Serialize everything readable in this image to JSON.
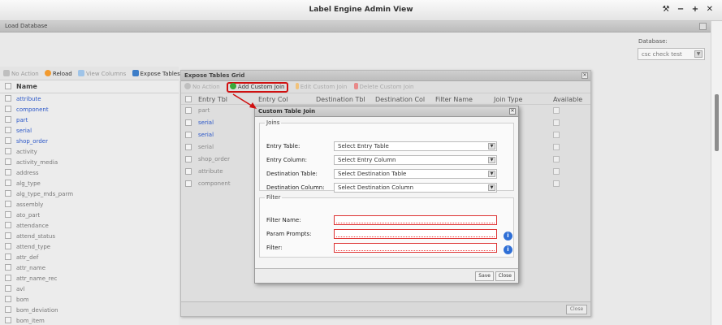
{
  "window": {
    "title": "Label Engine Admin View",
    "controls": "⚒ − + ✕"
  },
  "load_database": {
    "label": "Load Database"
  },
  "database": {
    "label": "Database:",
    "selected": "csc check test"
  },
  "left_toolbar": {
    "no_action": "No Action",
    "reload": "Reload",
    "view_columns": "View Columns",
    "expose_tables": "Expose Tables"
  },
  "left_grid": {
    "header": "Name",
    "rows": [
      "attribute",
      "component",
      "part",
      "serial",
      "shop_order",
      "activity",
      "activity_media",
      "address",
      "alg_type",
      "alg_type_mds_parm",
      "assembly",
      "ato_part",
      "attendance",
      "attend_status",
      "attend_type",
      "attr_def",
      "attr_name",
      "attr_name_rec",
      "avl",
      "bom",
      "bom_deviation",
      "bom_item"
    ]
  },
  "expose_grid": {
    "title": "Expose Tables Grid",
    "toolbar": {
      "no_action": "No Action",
      "add_join": "Add Custom Join",
      "edit_join": "Edit Custom Join",
      "delete_join": "Delete Custom Join"
    },
    "columns": [
      "Entry Tbl",
      "Entry Col",
      "Destination Tbl",
      "Destination Col",
      "Filter Name",
      "Join Type",
      "Available"
    ],
    "rows": [
      "part",
      "serial",
      "serial",
      "serial",
      "shop_order",
      "attribute",
      "component"
    ],
    "close": "Close"
  },
  "dialog": {
    "title": "Custom Table Join",
    "joins_legend": "Joins",
    "entry_table": {
      "label": "Entry Table:",
      "value": "Select Entry Table"
    },
    "entry_column": {
      "label": "Entry Column:",
      "value": "Select Entry Column"
    },
    "dest_table": {
      "label": "Destination Table:",
      "value": "Select Destination Table"
    },
    "dest_column": {
      "label": "Destination Column:",
      "value": "Select Destination Column"
    },
    "filter_legend": "Filter",
    "filter_name": "Filter Name:",
    "param_prompts": "Param Prompts:",
    "filter": "Filter:",
    "save": "Save",
    "close": "Close"
  },
  "colors": {
    "highlight": "#d01010",
    "link": "#2b57c8",
    "info": "#2f6fd6"
  }
}
